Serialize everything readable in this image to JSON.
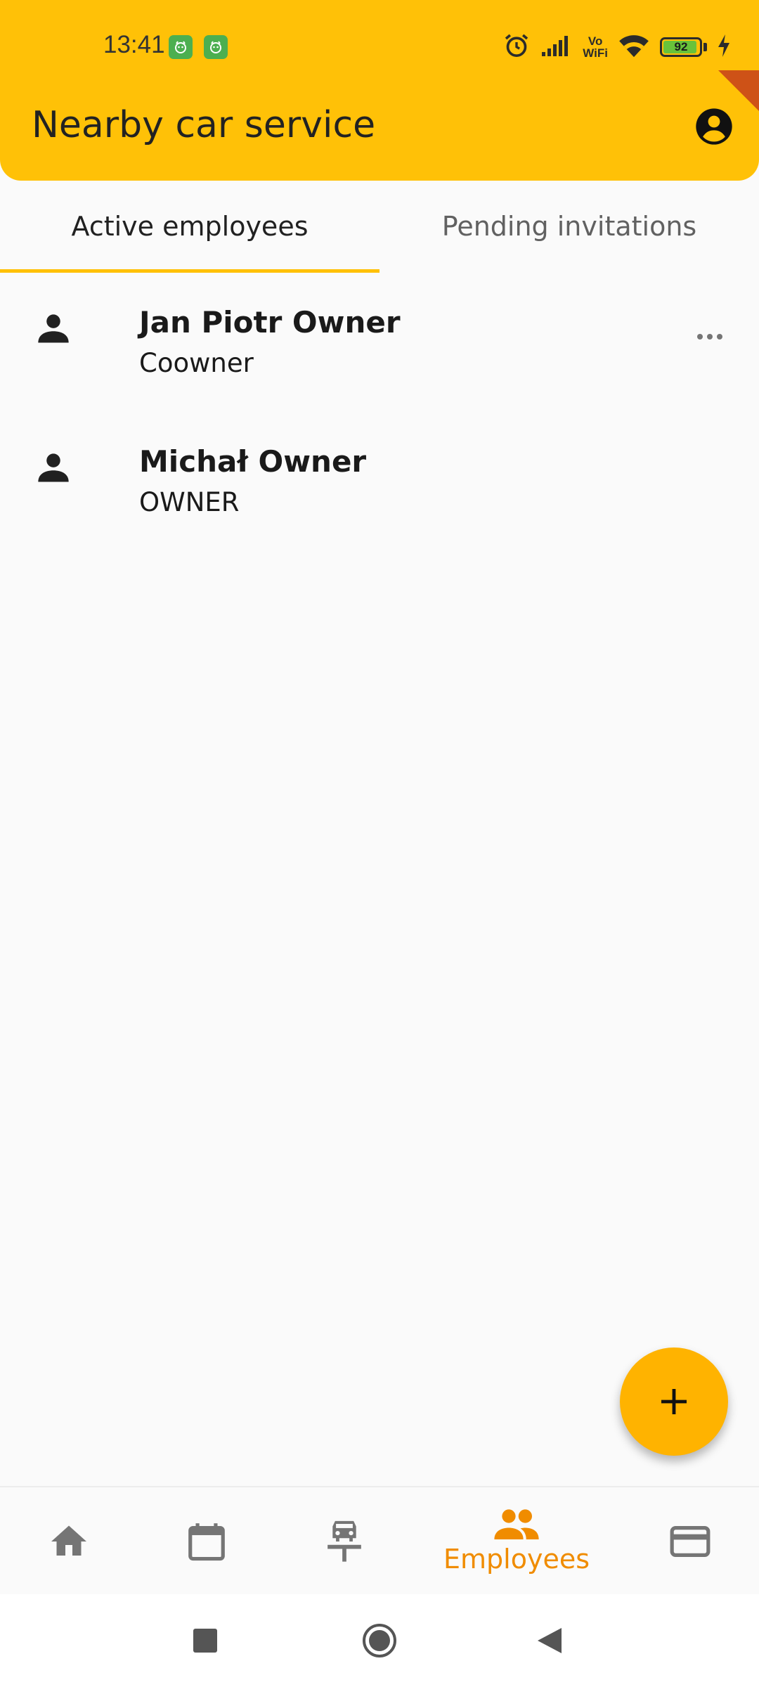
{
  "status_bar": {
    "time": "13:41",
    "wifi_calling_line1": "Vo",
    "wifi_calling_line2": "WiFi",
    "battery_level": "92",
    "icons": [
      "app-notification-icon",
      "app-notification-icon",
      "alarm-icon",
      "signal-icon",
      "vowifi-icon",
      "wifi-icon",
      "battery-icon",
      "charging-icon"
    ]
  },
  "header": {
    "title": "Nearby car service",
    "account_icon": "account-circle-icon"
  },
  "tabs": [
    {
      "label": "Active employees",
      "selected": true
    },
    {
      "label": "Pending invitations",
      "selected": false
    }
  ],
  "employees": [
    {
      "name": "Jan Piotr Owner",
      "role": "Coowner",
      "has_menu": true
    },
    {
      "name": "Michał Owner",
      "role": "OWNER",
      "has_menu": false
    }
  ],
  "fab": {
    "icon": "add-icon"
  },
  "bottom_nav": {
    "items": [
      {
        "icon": "home-icon",
        "label": ""
      },
      {
        "icon": "calendar-icon",
        "label": ""
      },
      {
        "icon": "car-service-icon",
        "label": ""
      },
      {
        "icon": "people-icon",
        "label": "Employees",
        "active": true
      },
      {
        "icon": "credit-card-icon",
        "label": ""
      }
    ]
  },
  "colors": {
    "primary": "#FFC107",
    "accent": "#FFB300",
    "active_nav": "#F08C00",
    "icon_inactive": "#757575"
  }
}
